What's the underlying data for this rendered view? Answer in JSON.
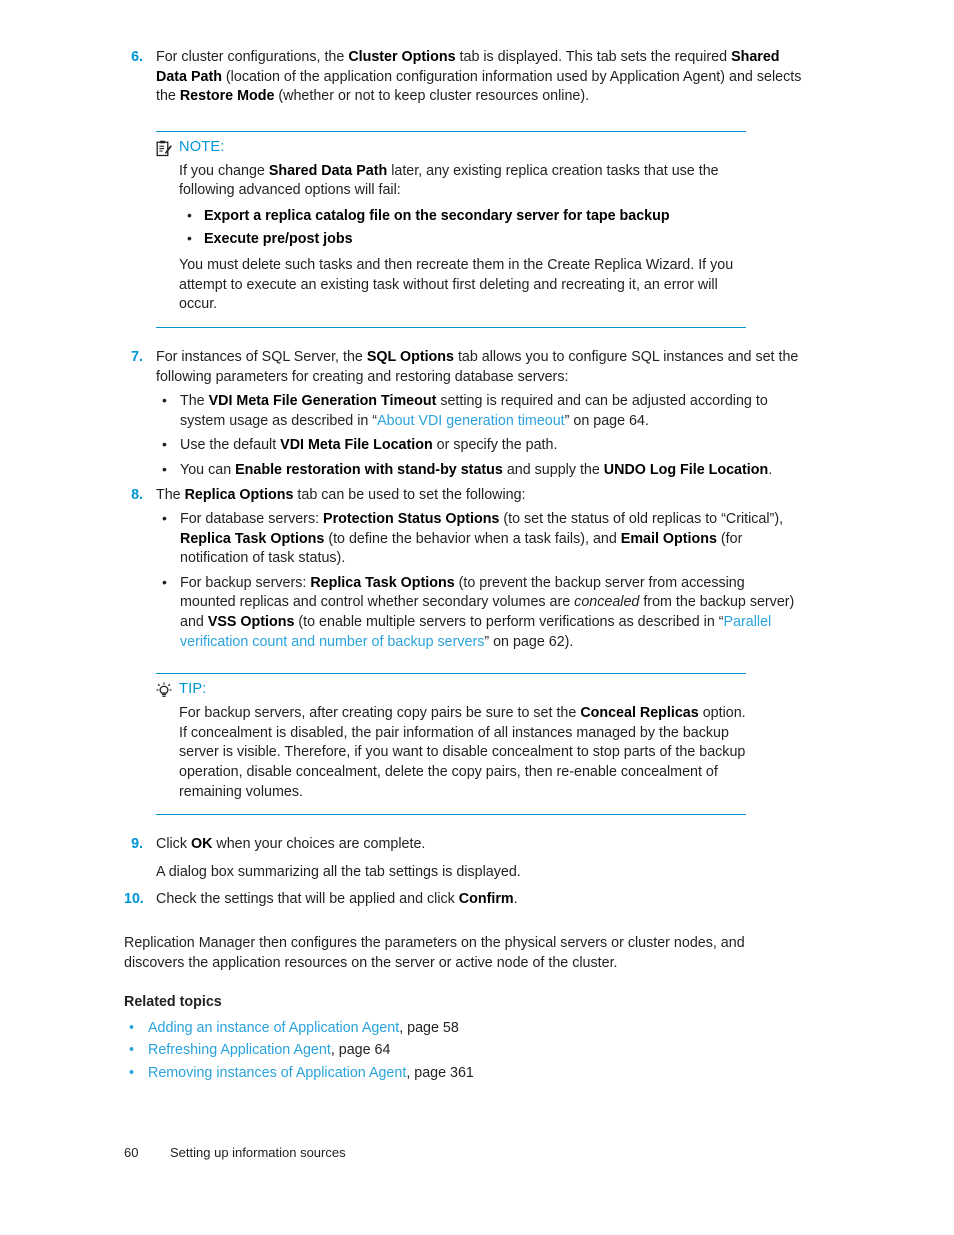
{
  "colors": {
    "accent": "#0096d6",
    "link": "#2aa3dc",
    "text": "#231f20",
    "rule": "#0096d6"
  },
  "steps": {
    "step6": {
      "number": "6.",
      "text_1": "For cluster configurations, the ",
      "bold_1": "Cluster Options",
      "text_2": " tab is displayed. This tab sets the required ",
      "bold_2": "Shared Data Path",
      "text_3": " (location of the application configuration information used by Application Agent) and selects the ",
      "bold_3": "Restore Mode",
      "text_4": " (whether or not to keep cluster resources online)."
    },
    "step7": {
      "number": "7.",
      "text_1": "For instances of SQL Server, the ",
      "bold_1": "SQL Options",
      "text_2": " tab allows you to configure SQL instances and set the following parameters for creating and restoring database servers:",
      "bullets": [
        {
          "t1": "The ",
          "b1": "VDI Meta File Generation Timeout",
          "t2": " setting is required and can be adjusted according to system usage as described in “",
          "link": "About VDI generation timeout",
          "t3": "” on page 64."
        },
        {
          "t1": "Use the default ",
          "b1": "VDI Meta File Location",
          "t2": " or specify the path."
        },
        {
          "t1": "You can ",
          "b1": "Enable restoration with stand-by status",
          "t2": " and supply the ",
          "b2": "UNDO Log File Location",
          "t3": "."
        }
      ]
    },
    "step8": {
      "number": "8.",
      "text_1": "The ",
      "bold_1": "Replica Options",
      "text_2": " tab can be used to set the following:",
      "bullets": [
        {
          "t1": "For database servers: ",
          "b1": "Protection Status Options",
          "t2": " (to set the status of old replicas to “Critical”), ",
          "b2": "Replica Task Options",
          "t3": " (to define the behavior when a task fails), and ",
          "b3": "Email Options",
          "t4": " (for notification of task status)."
        },
        {
          "t1": "For backup servers: ",
          "b1": "Replica Task Options",
          "t2": " (to prevent the backup server from accessing mounted replicas and control whether secondary volumes are ",
          "i1": "concealed",
          "t3": " from the backup server) and ",
          "b2": "VSS Options",
          "t4": " (to enable multiple servers to perform verifications as described in “",
          "link": "Parallel verification count and number of backup servers",
          "t5": "” on page 62)."
        }
      ]
    },
    "step9": {
      "number": "9.",
      "text_1": "Click ",
      "bold_1": "OK",
      "text_2": " when your choices are complete.",
      "sub_para": "A dialog box summarizing all the tab settings is displayed."
    },
    "step10": {
      "number": "10.",
      "text_1": "Check the settings that will be applied and click ",
      "bold_1": "Confirm",
      "text_2": "."
    }
  },
  "note": {
    "icon": "note-clipboard-icon",
    "title": "NOTE:",
    "para_1_t1": "If you change ",
    "para_1_b1": "Shared Data Path",
    "para_1_t2": " later, any existing replica creation tasks that use the following advanced options will fail:",
    "bullets": [
      "Export a replica catalog file on the secondary server for tape backup",
      "Execute pre/post jobs"
    ],
    "para_2": "You must delete such tasks and then recreate them in the Create Replica Wizard. If you attempt to execute an existing task without first deleting and recreating it, an error will occur."
  },
  "tip": {
    "icon": "lightbulb-icon",
    "title": "TIP:",
    "para_t1": "For backup servers, after creating copy pairs be sure to set the ",
    "para_b1": "Conceal Replicas",
    "para_t2": " option. If concealment is disabled, the pair information of all instances managed by the backup server is visible. Therefore, if you want to disable concealment to stop parts of the backup operation, disable concealment, delete the copy pairs, then re-enable concealment of remaining volumes."
  },
  "closing_para": "Replication Manager then configures the parameters on the physical servers or cluster nodes, and discovers the application resources on the server or active node of the cluster.",
  "related": {
    "heading": "Related topics",
    "items": [
      {
        "link": "Adding an instance of Application Agent",
        "tail": ", page 58"
      },
      {
        "link": "Refreshing Application Agent",
        "tail": ", page 64"
      },
      {
        "link": "Removing instances of Application Agent",
        "tail": ", page 361"
      }
    ]
  },
  "footer": {
    "page_number": "60",
    "chapter_title": "Setting up information sources"
  }
}
